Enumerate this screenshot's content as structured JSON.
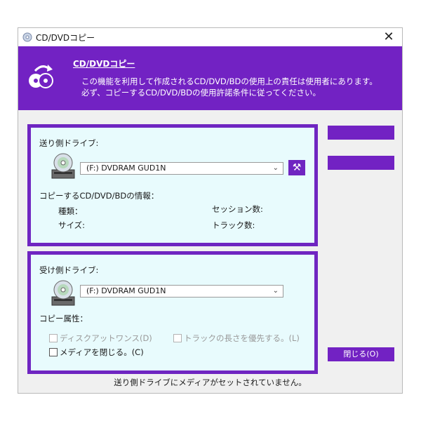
{
  "window": {
    "title": "CD/DVDコピー",
    "close_glyph": "✕"
  },
  "banner": {
    "heading": "CD/DVDコピー",
    "line1": "この機能を利用して作成されるCD/DVD/BDの使用上の責任は使用者にあります。",
    "line2": "必ず、コピーするCD/DVD/BDの使用許諾条件に従ってください。"
  },
  "source": {
    "label": "送り側ドライブ:",
    "drive_value": "(F:) DVDRAM GUD1N",
    "info_label": "コピーするCD/DVD/BDの情報：",
    "type_label": "種類：",
    "size_label": "サイズ:",
    "session_label": "セッション数:",
    "track_label": "トラック数:"
  },
  "dest": {
    "label": "受け側ドライブ:",
    "drive_value": "(F:) DVDRAM GUD1N",
    "attr_label": "コピー属性：",
    "opt_disc_at_once": "ディスクアットワンス(D)",
    "opt_track_length": "トラックの長さを優先する。(L)",
    "opt_close_media": "メディアを閉じる。(C)"
  },
  "side_buttons": {
    "close_label": "閉じる(O)"
  },
  "status": {
    "message": "送り側ドライブにメディアがセットされていません。"
  },
  "colors": {
    "accent": "#7222c3",
    "panel_bg": "#e8fbfd"
  }
}
